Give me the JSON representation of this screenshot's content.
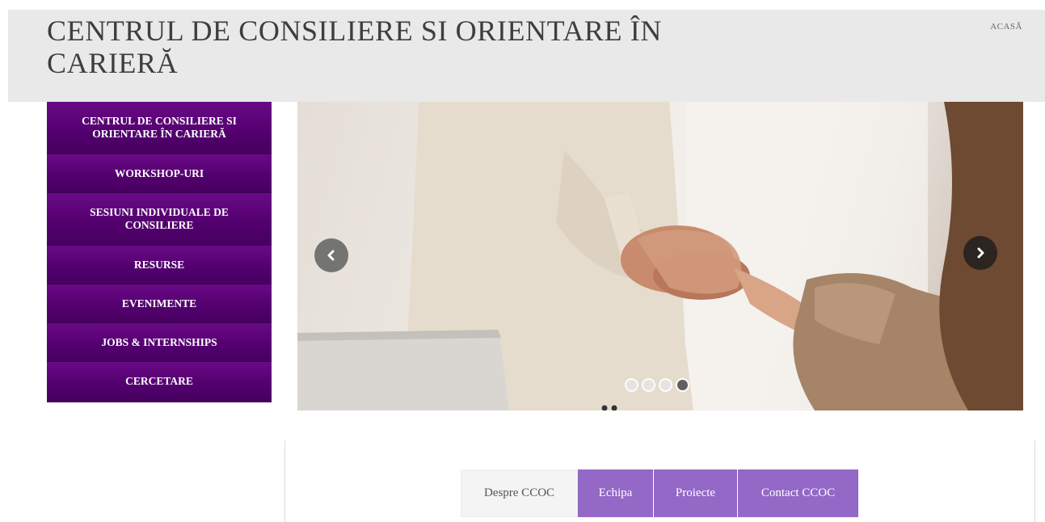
{
  "header": {
    "title": "CENTRUL DE CONSILIERE SI ORIENTARE ÎN CARIERĂ",
    "nav_home": "ACASĂ"
  },
  "sidebar": {
    "items": [
      {
        "label": "CENTRUL DE CONSILIERE SI ORIENTARE ÎN CARIERĂ"
      },
      {
        "label": "WORKSHOP-URI"
      },
      {
        "label": "SESIUNI INDIVIDUALE DE CONSILIERE"
      },
      {
        "label": "RESURSE"
      },
      {
        "label": "EVENIMENTE"
      },
      {
        "label": "JOBS & INTERNSHIPS"
      },
      {
        "label": "CERCETARE"
      }
    ]
  },
  "slider": {
    "image": "handshake-photo",
    "prev_icon": "chevron-left-icon",
    "next_icon": "chevron-right-icon",
    "slide_count": 4,
    "active_slide": 4
  },
  "tabs": [
    {
      "label": "Despre CCOC",
      "active": true
    },
    {
      "label": "Echipa",
      "active": false
    },
    {
      "label": "Proiecte",
      "active": false
    },
    {
      "label": "Contact CCOC",
      "active": false
    }
  ],
  "colors": {
    "sidebar": "#540070",
    "tab_accent": "#9368c6",
    "header_bg": "#e9e9e9"
  }
}
